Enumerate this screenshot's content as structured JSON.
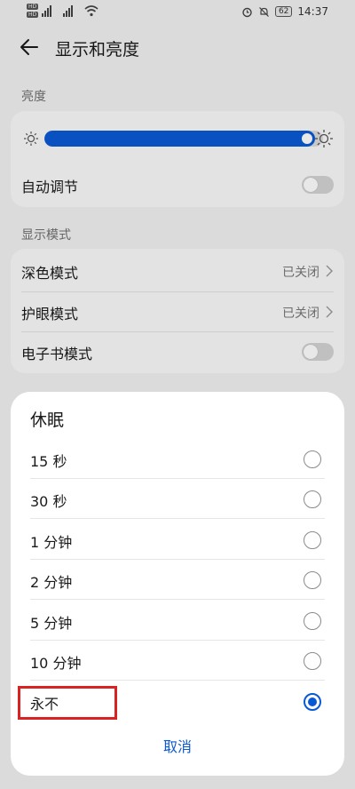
{
  "status_bar": {
    "hd1": "HD",
    "hd2": "HD",
    "signal1": "4G",
    "signal2": "4G",
    "battery": "62",
    "time": "14:37"
  },
  "header": {
    "title": "显示和亮度"
  },
  "brightness": {
    "section_label": "亮度",
    "level_percent": 97,
    "auto_adjust_label": "自动调节",
    "auto_adjust_on": false
  },
  "display_mode": {
    "section_label": "显示模式",
    "items": [
      {
        "label": "深色模式",
        "value": "已关闭"
      },
      {
        "label": "护眼模式",
        "value": "已关闭"
      },
      {
        "label": "电子书模式",
        "toggle_on": false
      }
    ]
  },
  "sleep_dialog": {
    "title": "休眠",
    "options": [
      {
        "label": "15 秒",
        "selected": false
      },
      {
        "label": "30 秒",
        "selected": false
      },
      {
        "label": "1 分钟",
        "selected": false
      },
      {
        "label": "2 分钟",
        "selected": false
      },
      {
        "label": "5 分钟",
        "selected": false
      },
      {
        "label": "10 分钟",
        "selected": false
      },
      {
        "label": "永不",
        "selected": true
      }
    ],
    "cancel_label": "取消"
  },
  "colors": {
    "accent": "#0a59d4",
    "highlight": "#d92323"
  }
}
